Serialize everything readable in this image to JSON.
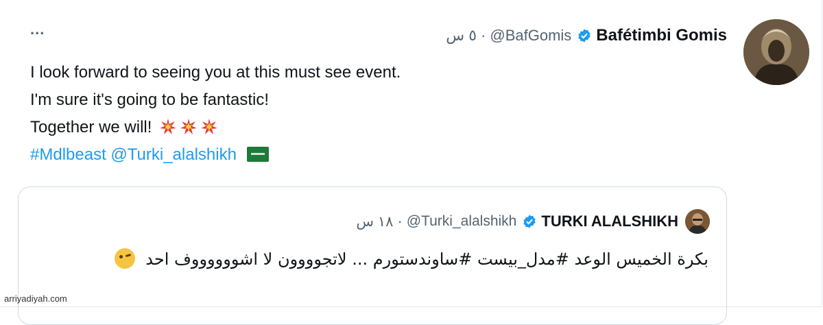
{
  "tweet": {
    "author_name": "Bafétimbi Gomis",
    "handle": "@BafGomis",
    "separator": "·",
    "time": "٥ س",
    "more": "...",
    "lines": [
      "I look forward to seeing you at this must see event.",
      "I'm sure it's going to be fantastic!",
      "Together we will!"
    ],
    "hashtag": "#Mdlbeast",
    "mention": "@Turki_alalshikh"
  },
  "quoted": {
    "author_name": "TURKI ALALSHIKH",
    "handle": "@Turki_alalshikh",
    "separator": "·",
    "time": "١٨ س",
    "text": "بكرة الخميس الوعد #مدل_بيست #ساوندستورم ... لاتجوووون لا اشووووووف احد"
  },
  "watermark": "arriyadiyah.com",
  "colors": {
    "link": "#1d9bf0",
    "verified": "#1d9bf0",
    "muted": "#536471"
  }
}
